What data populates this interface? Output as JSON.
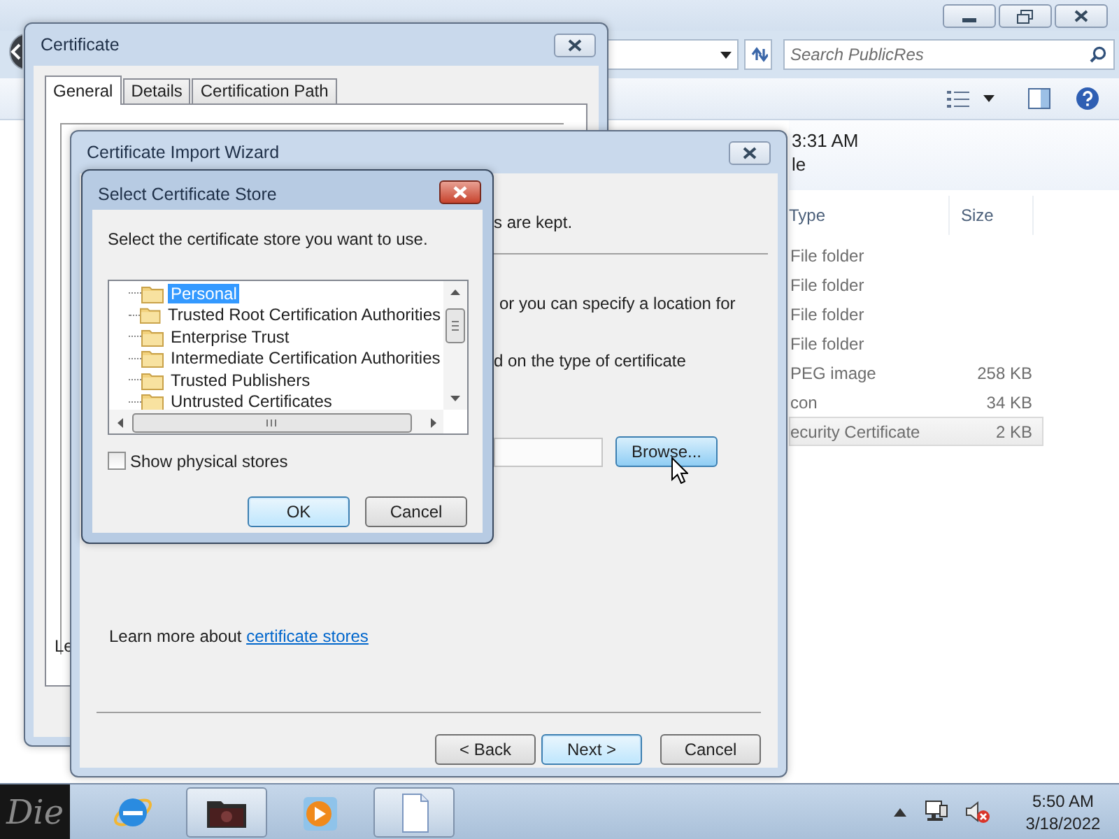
{
  "explorer": {
    "search_placeholder": "Search PublicRes",
    "details": [
      "3:31 AM",
      "le"
    ],
    "columns": [
      "Type",
      "Size"
    ],
    "rows": [
      {
        "type": "File folder",
        "selected": false
      },
      {
        "type": "File folder",
        "selected": false
      },
      {
        "type": "File folder",
        "selected": false
      },
      {
        "type": "File folder",
        "selected": false
      },
      {
        "type": "PEG image",
        "size": "258 KB",
        "selected": false
      },
      {
        "type": "con",
        "size": "34 KB",
        "selected": false
      },
      {
        "type": "ecurity Certificate",
        "size": "2 KB",
        "selected": true
      }
    ]
  },
  "certificate_window": {
    "title": "Certificate",
    "tabs": [
      {
        "label": "General",
        "selected": true
      },
      {
        "label": "Details",
        "selected": false
      },
      {
        "label": "Certification Path",
        "selected": false
      }
    ],
    "partial_text": "Le"
  },
  "import_wizard": {
    "title": "Certificate Import Wizard",
    "partial_lines": [
      "s are kept.",
      "or you can specify a location for",
      "d on the type of certificate"
    ],
    "browse_button": "Browse...",
    "learn_more": "Learn more about",
    "learn_more_link": "certificate stores",
    "buttons": [
      {
        "label": "< Back",
        "default": false
      },
      {
        "label": "Next >",
        "default": true
      },
      {
        "label": "Cancel",
        "default": false
      }
    ]
  },
  "store_dialog": {
    "title": "Select Certificate Store",
    "prompt": "Select the certificate store you want to use.",
    "stores": [
      {
        "label": "Personal",
        "selected": true
      },
      {
        "label": "Trusted Root Certification Authorities",
        "selected": false
      },
      {
        "label": "Enterprise Trust",
        "selected": false
      },
      {
        "label": "Intermediate Certification Authorities",
        "selected": false
      },
      {
        "label": "Trusted Publishers",
        "selected": false
      },
      {
        "label": "Untrusted Certificates",
        "selected": false
      }
    ],
    "show_physical_stores": {
      "label": "Show physical stores",
      "checked": false
    },
    "buttons": [
      {
        "label": "OK",
        "default": true
      },
      {
        "label": "Cancel",
        "default": false
      }
    ]
  },
  "taskbar": {
    "start_label": "Die",
    "apps": [
      {
        "kind": "browser",
        "active": false
      },
      {
        "kind": "folder",
        "active": true
      },
      {
        "kind": "media",
        "active": false
      },
      {
        "kind": "document",
        "active": true
      }
    ],
    "time": "5:50 AM",
    "date": "3/18/2022"
  }
}
